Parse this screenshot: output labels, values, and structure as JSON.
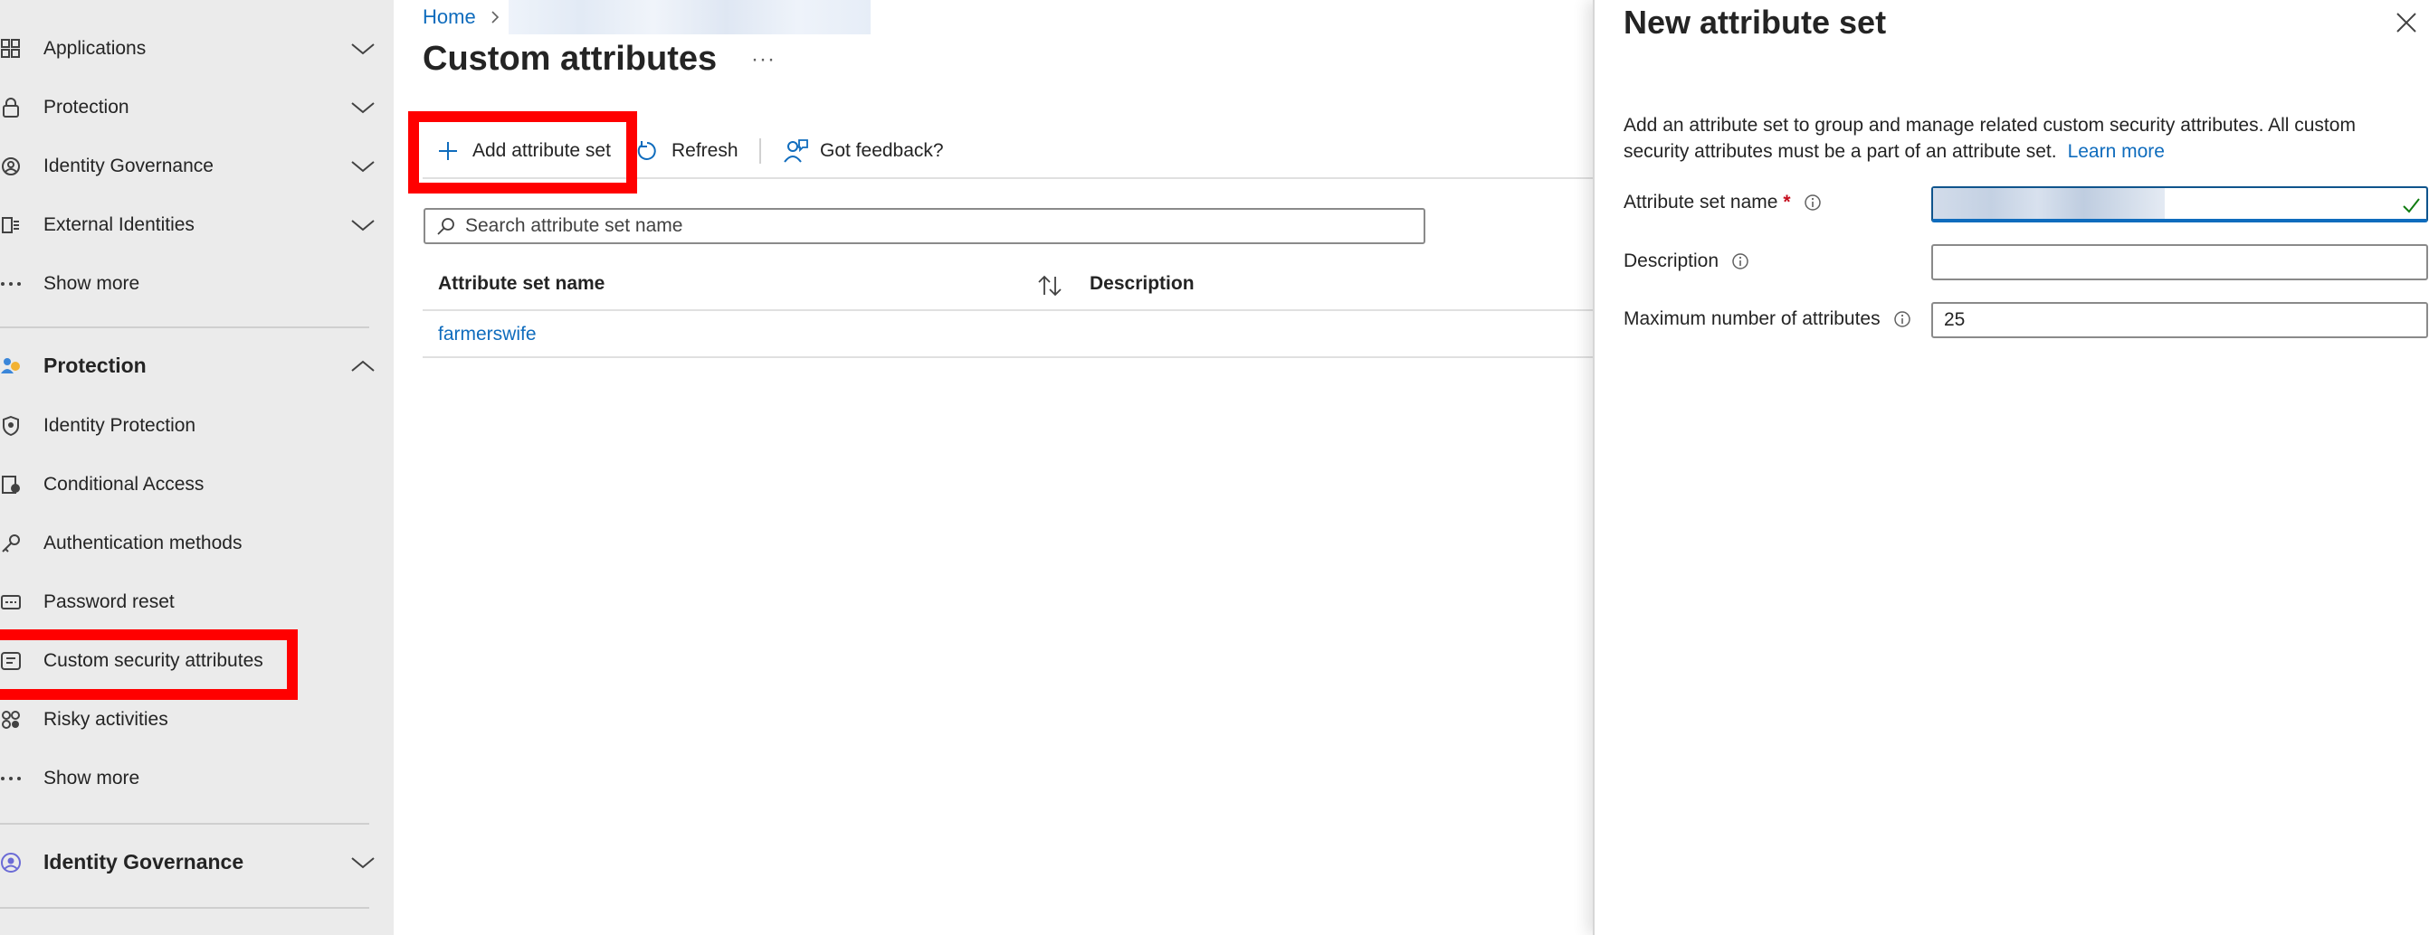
{
  "sidebar": {
    "items": [
      {
        "label": "Applications",
        "icon": "applications-icon"
      },
      {
        "label": "Protection",
        "icon": "lock-icon"
      },
      {
        "label": "Identity Governance",
        "icon": "identity-governance-icon"
      },
      {
        "label": "External Identities",
        "icon": "external-identities-icon"
      },
      {
        "label": "Show more",
        "icon": "ellipsis-icon"
      }
    ],
    "section_protection": {
      "label": "Protection",
      "icon": "protection-people-icon",
      "items": [
        {
          "label": "Identity Protection",
          "icon": "shield-icon"
        },
        {
          "label": "Conditional Access",
          "icon": "conditional-access-icon"
        },
        {
          "label": "Authentication methods",
          "icon": "key-icon"
        },
        {
          "label": "Password reset",
          "icon": "password-icon"
        },
        {
          "label": "Custom security attributes",
          "icon": "attributes-icon"
        },
        {
          "label": "Risky activities",
          "icon": "risky-activities-icon"
        },
        {
          "label": "Show more",
          "icon": "ellipsis-icon"
        }
      ]
    },
    "section_governance": {
      "label": "Identity Governance",
      "icon": "identity-governance-icon"
    }
  },
  "main": {
    "breadcrumb_home": "Home",
    "title": "Custom attributes",
    "more": "···",
    "toolbar": {
      "add": "Add attribute set",
      "refresh": "Refresh",
      "feedback": "Got feedback?"
    },
    "search_placeholder": "Search attribute set name",
    "table": {
      "columns": [
        "Attribute set name",
        "Description"
      ],
      "rows": [
        {
          "name": "farmerswife",
          "description": ""
        }
      ]
    }
  },
  "panel": {
    "title": "New attribute set",
    "description": "Add an attribute set to group and manage related custom security attributes. All custom security attributes must be a part of an attribute set.",
    "learn_more": "Learn more",
    "fields": {
      "name_label": "Attribute set name",
      "required_mark": "*",
      "description_label": "Description",
      "max_label": "Maximum number of attributes",
      "max_value": "25"
    }
  },
  "colors": {
    "accent": "#0f6cbd",
    "highlight": "#ff0000",
    "sidebar_bg": "#ebebeb",
    "required": "#c50f1f",
    "valid": "#107c10"
  }
}
